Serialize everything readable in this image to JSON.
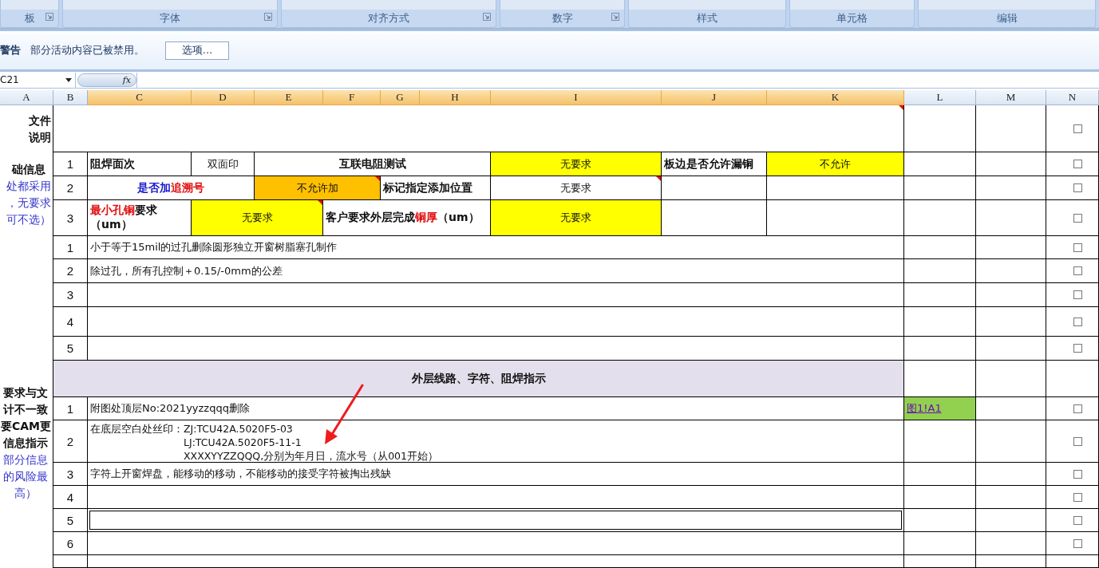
{
  "ribbon": {
    "groups": [
      {
        "label": "板",
        "launcher": true
      },
      {
        "label": "字体",
        "launcher": true
      },
      {
        "label": "对齐方式",
        "launcher": true
      },
      {
        "label": "数字",
        "launcher": true
      },
      {
        "label": "样式",
        "launcher": false
      },
      {
        "label": "单元格",
        "launcher": false
      },
      {
        "label": "编辑",
        "launcher": false
      }
    ]
  },
  "security_bar": {
    "title": "警告",
    "message": "部分活动内容已被禁用。",
    "button": "选项..."
  },
  "formula_bar": {
    "name_box": "C21",
    "fx": "fx"
  },
  "columns": [
    {
      "label": "A",
      "selected": false
    },
    {
      "label": "B",
      "selected": false
    },
    {
      "label": "C",
      "selected": true
    },
    {
      "label": "D",
      "selected": true
    },
    {
      "label": "E",
      "selected": true
    },
    {
      "label": "F",
      "selected": true
    },
    {
      "label": "G",
      "selected": true
    },
    {
      "label": "H",
      "selected": true
    },
    {
      "label": "I",
      "selected": true
    },
    {
      "label": "J",
      "selected": true
    },
    {
      "label": "K",
      "selected": true
    },
    {
      "label": "L",
      "selected": false
    },
    {
      "label": "M",
      "selected": false
    },
    {
      "label": "N",
      "selected": false
    }
  ],
  "column_a": [
    {
      "lines": [
        {
          "text": "文件",
          "kind": "heading"
        },
        {
          "text": "说明",
          "kind": "heading"
        }
      ]
    },
    {
      "lines": [
        {
          "text": "础信息",
          "kind": "heading"
        },
        {
          "text": "处都采用",
          "kind": "note"
        },
        {
          "text": "，无要求",
          "kind": "note"
        },
        {
          "text": "可不选）",
          "kind": "note"
        }
      ]
    },
    {
      "lines": [
        {
          "text": "要求与文",
          "kind": "heading"
        },
        {
          "text": "计不一致",
          "kind": "heading"
        },
        {
          "text": "要CAM更",
          "kind": "heading"
        },
        {
          "text": "信息指示",
          "kind": "heading"
        },
        {
          "text": "部分信息",
          "kind": "note"
        },
        {
          "text": "的风险最",
          "kind": "note"
        },
        {
          "text": "高）",
          "kind": "note"
        }
      ]
    }
  ],
  "rows": [
    {
      "cells": [
        {
          "note": true
        },
        {},
        {}
      ],
      "checkbox": {
        "checked": false
      }
    },
    {
      "cells": [
        {
          "kind": "number",
          "text": "1"
        },
        {
          "text": "阻焊面次",
          "bold": true
        },
        {
          "text": "双面印"
        },
        {
          "text": "互联电阻测试",
          "bold": true
        },
        {
          "text": "无要求",
          "color": "#ffff00"
        },
        {
          "text": "板边是否允许漏铜",
          "bold": true
        },
        {
          "text": "不允许",
          "color": "#ffff00"
        },
        {},
        {}
      ],
      "checkbox": {
        "checked": false
      }
    },
    {
      "cells": [
        {
          "kind": "number",
          "text": "2"
        },
        {
          "bold": true,
          "parts": [
            {
              "text": "是否加",
              "color": "#1a1acc"
            },
            {
              "text": "追溯号",
              "color": "#e01010"
            }
          ]
        },
        {
          "text": "不允许加",
          "color": "#ffc000",
          "note": true
        },
        {
          "text": "标记指定添加位置",
          "bold": true
        },
        {
          "text": "无要求",
          "note": true
        },
        {},
        {},
        {},
        {}
      ],
      "checkbox": {
        "checked": false
      }
    },
    {
      "cells": [
        {
          "kind": "number",
          "text": "3"
        },
        {
          "bold": true,
          "parts": [
            {
              "text": "最小孔铜",
              "color": "#e01010"
            },
            {
              "text": "要求（um）",
              "color": "#111111"
            }
          ]
        },
        {
          "text": "无要求",
          "color": "#ffff00",
          "note": true
        },
        {
          "bold": true,
          "parts": [
            {
              "text": "客户要求外层完成",
              "color": "#111111"
            },
            {
              "text": "铜厚",
              "color": "#e01010"
            },
            {
              "text": "（um）",
              "color": "#111111"
            }
          ]
        },
        {
          "text": "无要求",
          "color": "#ffff00"
        },
        {},
        {},
        {},
        {}
      ],
      "checkbox": {
        "checked": false
      }
    },
    {
      "cells": [
        {
          "kind": "number",
          "text": "1"
        },
        {
          "text": "小于等于15mil的过孔删除圆形独立开窗树脂塞孔制作"
        },
        {},
        {}
      ],
      "checkbox": {
        "checked": false
      }
    },
    {
      "cells": [
        {
          "kind": "number",
          "text": "2"
        },
        {
          "text": "除过孔，所有孔控制＋0.15/-0mm的公差"
        },
        {},
        {}
      ],
      "checkbox": {
        "checked": false
      }
    },
    {
      "cells": [
        {
          "kind": "number",
          "text": "3"
        },
        {},
        {},
        {}
      ],
      "checkbox": {
        "checked": false
      }
    },
    {
      "cells": [
        {
          "kind": "number",
          "text": "4"
        },
        {},
        {},
        {}
      ],
      "checkbox": {
        "checked": false
      }
    },
    {
      "cells": [
        {
          "kind": "number",
          "text": "5"
        },
        {},
        {},
        {}
      ],
      "checkbox": {
        "checked": false
      }
    },
    {
      "cells": [
        {
          "text": "外层线路、字符、阻焊指示",
          "bold": true,
          "color": "#e4dfec"
        },
        {},
        {}
      ]
    },
    {
      "cells": [
        {
          "kind": "number",
          "text": "1"
        },
        {
          "text": "附图处顶层No:2021yyzzqqq删除"
        },
        {
          "kind": "link",
          "text": "图1!A1",
          "color": "#92d050"
        },
        {}
      ],
      "checkbox": {
        "checked": false
      }
    },
    {
      "cells": [
        {
          "kind": "number",
          "text": "2"
        },
        {
          "kind": "labeled",
          "label": "在底层空白处丝印：",
          "lines": [
            "ZJ:TCU42A.5020F5-03",
            "LJ:TCU42A.5020F5-11-1",
            "XXXXYYZZQQQ,分别为年月日，流水号（从001开始）"
          ]
        },
        {},
        {}
      ],
      "checkbox": {
        "checked": false
      }
    },
    {
      "cells": [
        {
          "kind": "number",
          "text": "3"
        },
        {
          "text": "字符上开窗焊盘，能移动的移动，不能移动的接受字符被掏出残缺"
        },
        {},
        {}
      ],
      "checkbox": {
        "checked": false
      }
    },
    {
      "cells": [
        {
          "kind": "number",
          "text": "4"
        },
        {
          "selected": false
        },
        {},
        {}
      ],
      "checkbox": {
        "checked": false
      }
    },
    {
      "cells": [
        {
          "kind": "number",
          "text": "5"
        },
        {
          "selected": true
        },
        {},
        {}
      ],
      "checkbox": {
        "checked": false
      }
    },
    {
      "cells": [
        {
          "kind": "number",
          "text": "6"
        },
        {
          "selected": false
        },
        {},
        {}
      ],
      "checkbox": {
        "checked": false
      }
    },
    {
      "cells": [
        {
          "kind": "number"
        },
        {},
        {},
        {}
      ]
    }
  ],
  "annotations": [
    {
      "kind": "arrow"
    }
  ]
}
